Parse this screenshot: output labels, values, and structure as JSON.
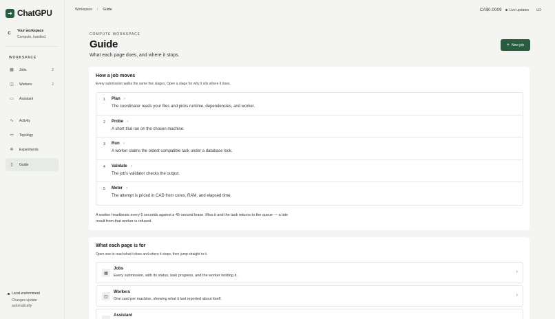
{
  "brand": {
    "name": "ChatGPU",
    "icon": "arrow-right-icon"
  },
  "workspace": {
    "avatar": "C",
    "title": "Your workspace",
    "subtitle": "Compute, handled."
  },
  "sidebar": {
    "section_label": "WORKSPACE",
    "items": [
      {
        "label": "Jobs",
        "count": "2",
        "icon": "grid-icon"
      },
      {
        "label": "Workers",
        "count": "2",
        "icon": "layers-icon"
      },
      {
        "label": "Assistant",
        "icon": "chat-icon"
      },
      {
        "label": "Activity",
        "icon": "pulse-icon"
      },
      {
        "label": "Topology",
        "icon": "link-icon"
      },
      {
        "label": "Experiments",
        "icon": "flask-icon"
      },
      {
        "label": "Guide",
        "icon": "book-icon"
      }
    ],
    "env": {
      "title": "Local environment",
      "line1": "Changes update",
      "line2": "automatically"
    }
  },
  "topbar": {
    "crumbs": [
      "Workspace",
      "Guide"
    ],
    "separator": "/",
    "balance": "CA$0.0009",
    "live": "Live updates",
    "user": "LD"
  },
  "header": {
    "eyebrow": "COMPUTE WORKSPACE",
    "title": "Guide",
    "subtitle": "What each page does, and where it stops.",
    "new_job": "New job"
  },
  "job_card": {
    "title": "How a job moves",
    "subtitle": "Every submission walks the same five stages. Open a stage for why it sits where it does.",
    "info_glyph": "?",
    "steps": [
      {
        "num": "1",
        "name": "Plan",
        "desc": "The coordinator reads your files and picks runtime, dependencies, and worker."
      },
      {
        "num": "2",
        "name": "Probe",
        "desc": "A short trial run on the chosen machine."
      },
      {
        "num": "3",
        "name": "Run",
        "desc": "A worker claims the oldest compatible task under a database lock."
      },
      {
        "num": "4",
        "name": "Validate",
        "desc": "The job's validator checks the output."
      },
      {
        "num": "5",
        "name": "Meter",
        "desc": "The attempt is priced in CAD from cores, RAM, and elapsed time."
      }
    ],
    "note": "A worker heartbeats every 5 seconds against a 45-second lease. Miss it and the task returns to the queue — a late result from that worker is refused."
  },
  "pages_card": {
    "title": "What each page is for",
    "subtitle": "Open one to read what it does and where it stops, then jump straight to it.",
    "pages": [
      {
        "name": "Jobs",
        "desc": "Every submission, with its status, task progress, and the worker holding it.",
        "icon": "grid-icon"
      },
      {
        "name": "Workers",
        "desc": "One card per machine, showing what it last reported about itself.",
        "icon": "layers-icon"
      },
      {
        "name": "Assistant",
        "desc": "",
        "icon": "chat-icon"
      }
    ]
  }
}
